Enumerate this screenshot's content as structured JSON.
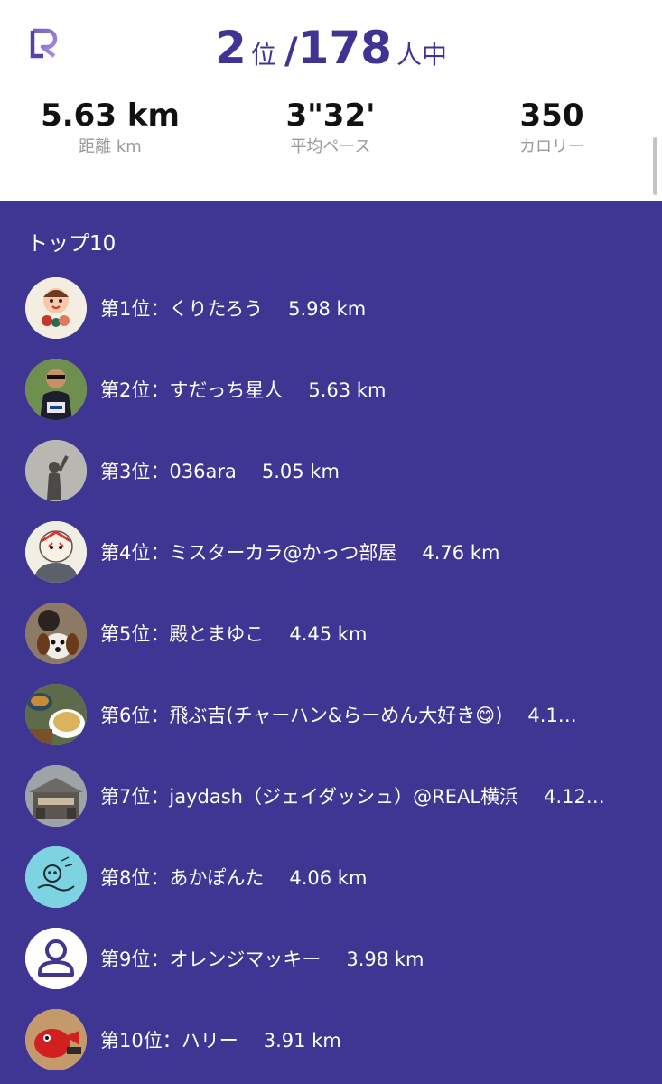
{
  "header": {
    "logo_icon": "runlog-r-logo-icon",
    "rank": "2",
    "rank_unit": "位",
    "rank_separator": "/",
    "total": "178",
    "total_unit": "人中",
    "accent_color": "#3f3493"
  },
  "stats": [
    {
      "value": "5.63 km",
      "label": "距離 km"
    },
    {
      "value": "3\"32'",
      "label": "平均ペース"
    },
    {
      "value": "350",
      "label": "カロリー"
    }
  ],
  "leaderboard": {
    "title": "トップ10",
    "background_color": "#3f3693",
    "items": [
      {
        "rank_label": "第1位：",
        "name": "くりたろう",
        "distance": "5.98 km",
        "avatar_icon": "cartoon-character-avatar"
      },
      {
        "rank_label": "第2位：",
        "name": "すだっち星人",
        "distance": "5.63 km",
        "avatar_icon": "runner-photo-avatar"
      },
      {
        "rank_label": "第3位：",
        "name": "036ara",
        "distance": "5.05 km",
        "avatar_icon": "shadow-photo-avatar"
      },
      {
        "rank_label": "第4位：",
        "name": "ミスターカラ@かっつ部屋",
        "distance": "4.76 km",
        "avatar_icon": "masked-wrestler-avatar"
      },
      {
        "rank_label": "第5位：",
        "name": "殿とまゆこ",
        "distance": "4.45 km",
        "avatar_icon": "dog-photo-avatar"
      },
      {
        "rank_label": "第6位：",
        "name": "飛ぶ吉(チャーハン&らーめん大好き😋)",
        "distance": "4.1…",
        "avatar_icon": "food-photo-avatar"
      },
      {
        "rank_label": "第7位：",
        "name": "jaydash（ジェイダッシュ）@REAL横浜",
        "distance": "4.12…",
        "avatar_icon": "building-photo-avatar"
      },
      {
        "rank_label": "第8位：",
        "name": "あかぽんた",
        "distance": "4.06 km",
        "avatar_icon": "sketch-drawing-avatar"
      },
      {
        "rank_label": "第9位：",
        "name": "オレンジマッキー",
        "distance": "3.98 km",
        "avatar_icon": "default-user-avatar"
      },
      {
        "rank_label": "第10位：",
        "name": "ハリー",
        "distance": "3.91 km",
        "avatar_icon": "red-character-avatar"
      }
    ]
  }
}
